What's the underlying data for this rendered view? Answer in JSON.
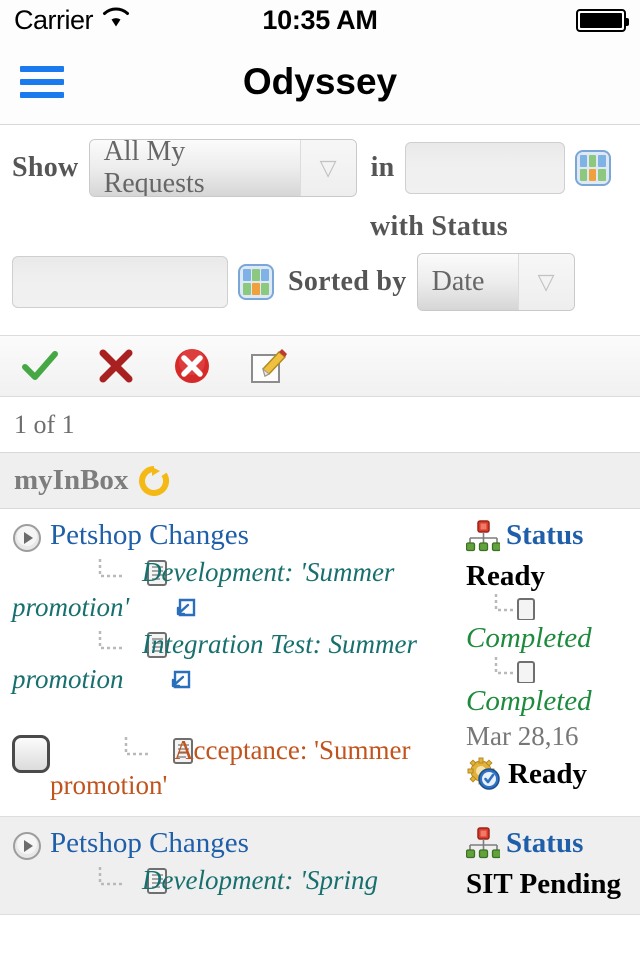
{
  "status_bar": {
    "carrier": "Carrier",
    "wifi_icon": "wifi-icon",
    "time": "10:35 AM",
    "battery_icon": "battery-full-icon"
  },
  "nav_bar": {
    "menu_icon": "hamburger-menu-icon",
    "title": "Odyssey",
    "accent_color": "#1a7aee"
  },
  "filter": {
    "show_label": "Show",
    "show_value": "All My Requests",
    "show_options": [
      "All My Requests"
    ],
    "in_label": "in",
    "in_value": "",
    "in_placeholder": "",
    "in_picker_icon": "calendar-grid-icon",
    "with_status_label": "with Status",
    "status_value": "",
    "status_placeholder": "",
    "status_picker_icon": "calendar-grid-icon",
    "sorted_by_label": "Sorted by",
    "sorted_by_value": "Date",
    "sorted_by_options": [
      "Date"
    ],
    "dropdown_arrow_icon": "chevron-down-icon"
  },
  "toolbar": {
    "items": [
      {
        "name": "approve-button",
        "icon": "green-check-icon",
        "color": "#3fa03f"
      },
      {
        "name": "reject-button",
        "icon": "red-x-icon",
        "color": "#a82020"
      },
      {
        "name": "cancel-button",
        "icon": "red-circle-x-icon",
        "color": "#d42020"
      },
      {
        "name": "edit-button",
        "icon": "edit-pencil-icon",
        "color": "#e8a31a"
      }
    ]
  },
  "pagination": {
    "count_text": "1 of 1"
  },
  "inbox": {
    "title": "myInBox",
    "refresh_icon": "refresh-circle-icon",
    "refresh_color": "#f5b916"
  },
  "requests": [
    {
      "title": "Petshop Changes",
      "expand_icon": "play-circle-icon",
      "children": [
        {
          "text": "Development: 'Summer promotion'",
          "doc_icon": "document-icon",
          "link_icon": "external-link-icon"
        },
        {
          "text": "Integration Test: Summer promotion",
          "doc_icon": "document-icon",
          "link_icon": "external-link-icon"
        }
      ],
      "acceptance": {
        "text": "Acceptance: 'Summer promotion'",
        "checkbox_icon": "checkbox-unchecked-icon",
        "doc_icon": "document-icon"
      },
      "status_header": {
        "label": "Status",
        "icon": "hierarchy-icon"
      },
      "status_values": [
        "Ready",
        "Completed",
        "Completed"
      ],
      "date": "Mar 28,16",
      "final_status": "Ready",
      "final_status_icon": "gear-check-icon"
    },
    {
      "title": "Petshop Changes",
      "expand_icon": "play-circle-icon",
      "children": [
        {
          "text": "Development: 'Spring",
          "doc_icon": "document-icon",
          "link_icon": "external-link-icon"
        }
      ],
      "status_header": {
        "label": "Status",
        "icon": "hierarchy-icon"
      },
      "status_values": [
        "SIT Pending"
      ]
    }
  ]
}
